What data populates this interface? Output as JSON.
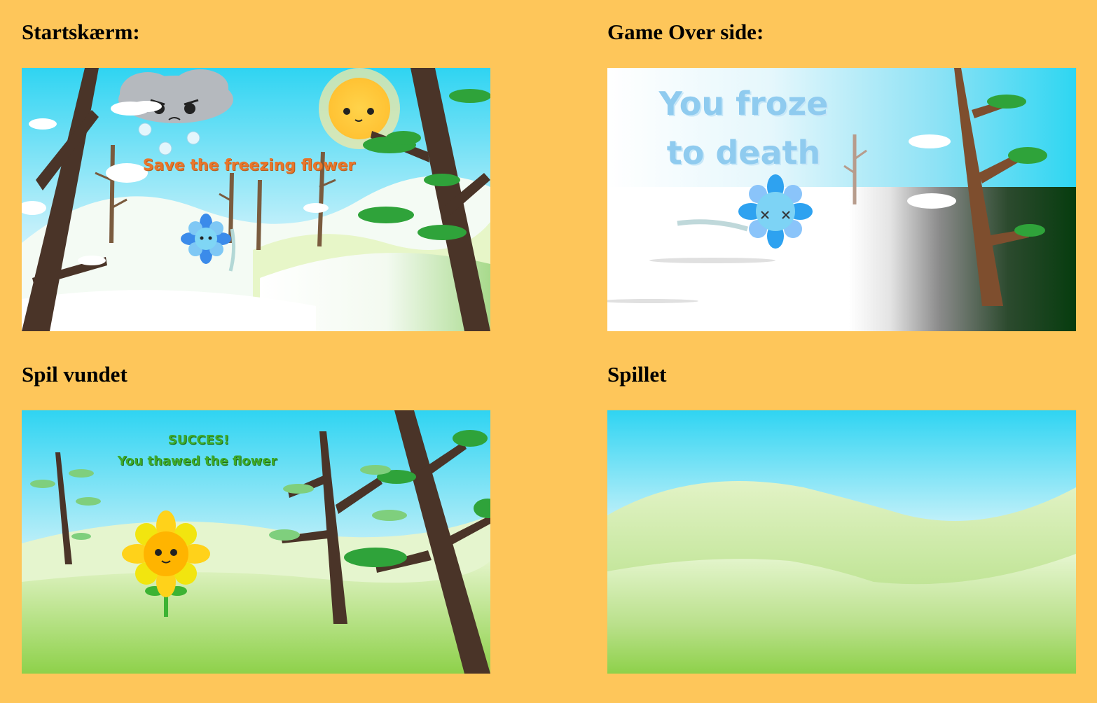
{
  "panels": {
    "start": {
      "heading": "Startskærm:",
      "overlay": "Save the freezing flower"
    },
    "gameover": {
      "heading": "Game Over side:",
      "overlay_line1": "You froze",
      "overlay_line2": "to death"
    },
    "won": {
      "heading": "Spil vundet",
      "overlay_line1": "SUCCES!",
      "overlay_line2": "You thawed the flower"
    },
    "game": {
      "heading": "Spillet"
    }
  },
  "colors": {
    "page_background": "#FEC65A",
    "sky_top": "#2FD4F2",
    "sky_bottom": "#E6FAFF",
    "hill_green": "#8ED14A",
    "trunk": "#4A3428",
    "pine_green": "#2FA33A",
    "start_title": "#E8762B",
    "success_title": "#3DAA2A",
    "frozen_title": "#8FCBEF"
  }
}
